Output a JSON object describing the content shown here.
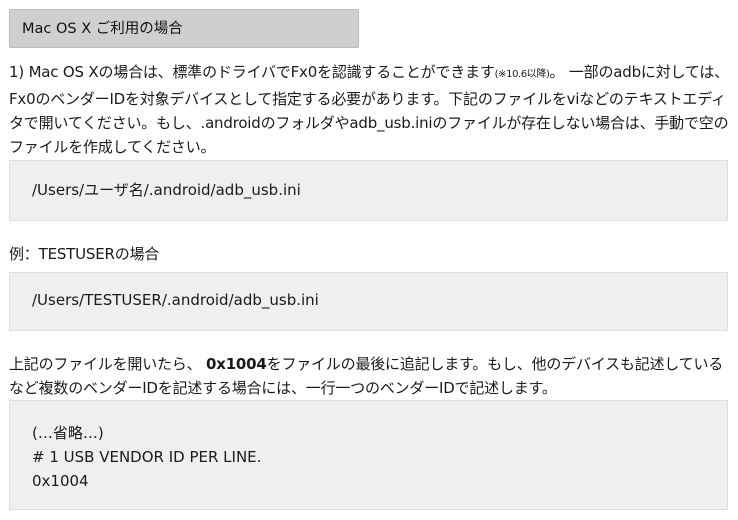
{
  "section_title": "Mac OS X ご利用の場合",
  "intro": {
    "part1": "1) Mac OS Xの場合は、標準のドライバでFx0を認識することができます",
    "note": "(※10.6以降)",
    "part2": "。 一部のadbに対しては、Fx0のベンダーIDを対象デバイスとして指定する必要があります。下記のファイルをviなどのテキストエディタで開いてください。もし、.androidのフォルダやadb_usb.iniのファイルが存在しない場合は、手動で空のファイルを作成してください。"
  },
  "path_box": {
    "line": "/Users/ユーザ名/.android/adb_usb.ini"
  },
  "example_label": "例：TESTUSERの場合",
  "example_box": {
    "line": "/Users/TESTUSER/.android/adb_usb.ini"
  },
  "instruction": {
    "part1": "上記のファイルを開いたら、 ",
    "vendor_id": "0x1004",
    "part2": "をファイルの最後に追記します。もし、他のデバイスも記述しているなど複数のベンダーIDを記述する場合には、一行一つのベンダーIDで記述します。"
  },
  "config_box": {
    "lines": [
      "(…省略…)",
      "# 1 USB VENDOR ID PER LINE.",
      "0x1004"
    ]
  }
}
